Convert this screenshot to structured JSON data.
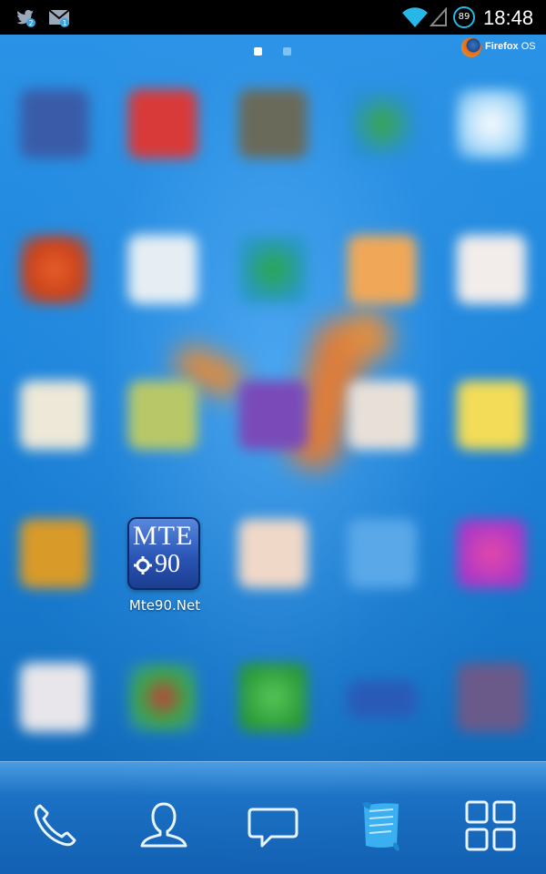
{
  "status_bar": {
    "time": "18:48",
    "battery_level": "89",
    "notification_icons": [
      "twitter-icon",
      "mail-icon"
    ],
    "system_icons": [
      "wifi-icon",
      "signal-icon",
      "battery-icon"
    ]
  },
  "page_indicator": {
    "current_page": 1,
    "total_pages": 2
  },
  "branding": {
    "logo_word_1": "Firefox",
    "logo_word_2": " OS"
  },
  "home": {
    "focused_app": {
      "label": "Mte90.Net",
      "logo_letters": "MTE",
      "logo_number": "90"
    }
  },
  "dock": {
    "items": [
      {
        "name": "phone",
        "icon": "phone-icon"
      },
      {
        "name": "contacts",
        "icon": "contacts-icon"
      },
      {
        "name": "messages",
        "icon": "messages-icon"
      },
      {
        "name": "marketplace",
        "icon": "marketplace-scroll-icon"
      },
      {
        "name": "apps",
        "icon": "apps-grid-icon"
      }
    ]
  },
  "colors": {
    "accent": "#28b8e8",
    "wallpaper": "#1a7fd0",
    "status_bar": "#000000"
  }
}
